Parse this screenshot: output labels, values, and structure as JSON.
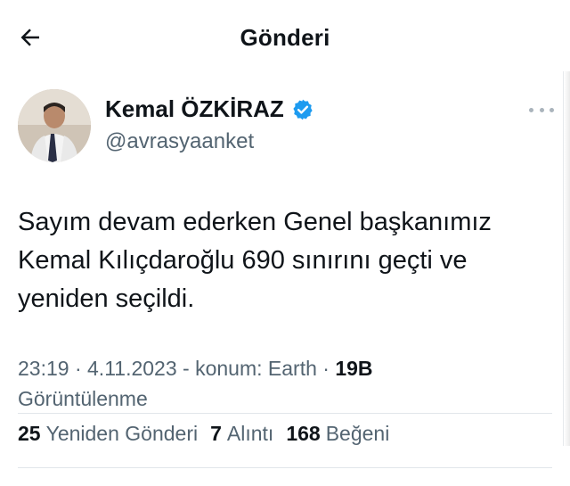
{
  "header": {
    "title": "Gönderi"
  },
  "author": {
    "name": "Kemal ÖZKİRAZ",
    "handle": "@avrasyaanket",
    "verified": true
  },
  "tweet": {
    "text": "Sayım devam ederken Genel başkanımız Kemal Kılıçdaroğlu 690 sınırını geçti ve yeniden seçildi."
  },
  "meta": {
    "time": "23:19",
    "date": "4.11.2023",
    "location": "konum: Earth",
    "views_count": "19B",
    "views_label": "Görüntülenme"
  },
  "stats": {
    "reposts_count": "25",
    "reposts_label": "Yeniden Gönderi",
    "quotes_count": "7",
    "quotes_label": "Alıntı",
    "likes_count": "168",
    "likes_label": "Beğeni"
  },
  "colors": {
    "text": "#0f1419",
    "secondary": "#536471",
    "verified": "#1d9bf0"
  },
  "icons": [
    "back-arrow-icon",
    "verified-badge-icon",
    "more-icon"
  ]
}
